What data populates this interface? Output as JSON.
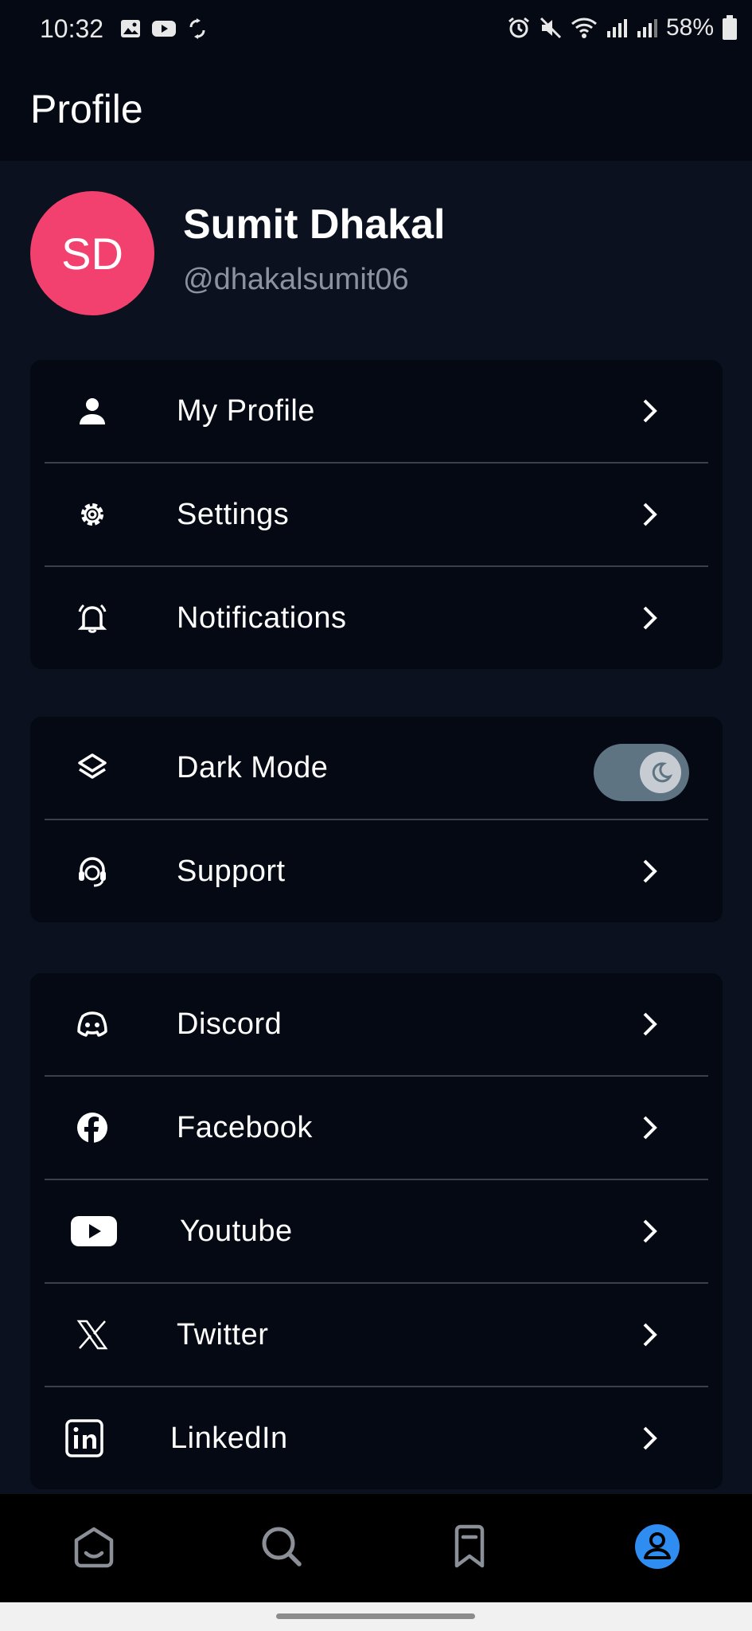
{
  "status_bar": {
    "time": "10:32",
    "battery": "58%"
  },
  "app_bar": {
    "title": "Profile"
  },
  "profile": {
    "initials": "SD",
    "name": "Sumit Dhakal",
    "handle": "@dhakalsumit06",
    "avatar_color": "#f2416e"
  },
  "section_account": [
    {
      "label": "My Profile",
      "icon": "person-icon"
    },
    {
      "label": "Settings",
      "icon": "gear-icon"
    },
    {
      "label": "Notifications",
      "icon": "bell-icon"
    }
  ],
  "section_preferences": {
    "dark_mode": {
      "label": "Dark Mode",
      "icon": "layers-icon",
      "enabled": true
    },
    "support": {
      "label": "Support",
      "icon": "headset-icon"
    }
  },
  "section_social": [
    {
      "label": "Discord",
      "icon": "discord-icon"
    },
    {
      "label": "Facebook",
      "icon": "facebook-icon"
    },
    {
      "label": "Youtube",
      "icon": "youtube-icon"
    },
    {
      "label": "Twitter",
      "icon": "x-twitter-icon"
    },
    {
      "label": "LinkedIn",
      "icon": "linkedin-icon"
    }
  ],
  "bottom_nav": {
    "items": [
      "home-icon",
      "search-icon",
      "bookmark-icon",
      "profile-icon"
    ],
    "active": "profile-icon",
    "accent_color": "#2f8df2"
  }
}
